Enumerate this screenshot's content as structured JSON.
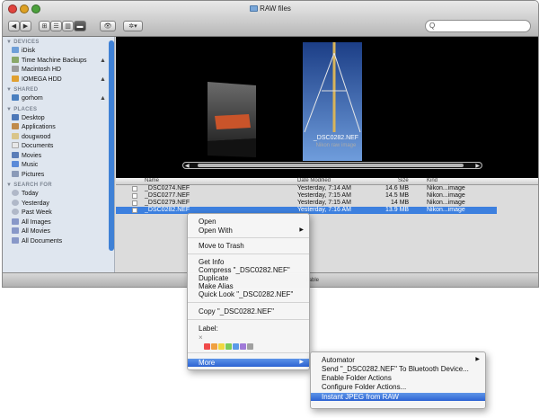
{
  "window": {
    "title": "RAW files"
  },
  "search": {
    "placeholder": "Q"
  },
  "sidebar": {
    "devices_header": "DEVICES",
    "devices": [
      {
        "label": "iDisk",
        "color": "#6f9fd8"
      },
      {
        "label": "Time Machine Backups",
        "color": "#8aa86a",
        "eject": "▲"
      },
      {
        "label": "Macintosh HD",
        "color": "#9c9c9c"
      },
      {
        "label": "IOMEGA HDD",
        "color": "#e0a030",
        "eject": "▲"
      }
    ],
    "shared_header": "SHARED",
    "shared": [
      {
        "label": "gorhom",
        "color": "#4a7fc0",
        "eject": "▲"
      }
    ],
    "places_header": "PLACES",
    "places": [
      {
        "label": "Desktop",
        "color": "#4d78b8"
      },
      {
        "label": "Applications",
        "color": "#c08a4a"
      },
      {
        "label": "dougwood",
        "color": "#d9c58a"
      },
      {
        "label": "Documents",
        "color": "#e8e8e8"
      },
      {
        "label": "Movies",
        "color": "#5a7db8"
      },
      {
        "label": "Music",
        "color": "#5a8ad8"
      },
      {
        "label": "Pictures",
        "color": "#8a9ab8"
      }
    ],
    "search_header": "SEARCH FOR",
    "searches": [
      {
        "label": "Today",
        "color": "#b0b8c8"
      },
      {
        "label": "Yesterday",
        "color": "#b0b8c8"
      },
      {
        "label": "Past Week",
        "color": "#b0b8c8"
      },
      {
        "label": "All Images",
        "color": "#8898c8"
      },
      {
        "label": "All Movies",
        "color": "#8898c8"
      },
      {
        "label": "All Documents",
        "color": "#8898c8"
      }
    ]
  },
  "coverflow": {
    "filename": "_DSC0282.NEF",
    "kind": "Nikon raw image"
  },
  "list": {
    "headers": {
      "name": "Name",
      "date": "Date Modified",
      "size": "Size",
      "kind": "Kind"
    },
    "rows": [
      {
        "name": "_DSC0274.NEF",
        "date": "Yesterday, 7:14 AM",
        "size": "14.6 MB",
        "kind": "Nikon...image"
      },
      {
        "name": "_DSC0277.NEF",
        "date": "Yesterday, 7:15 AM",
        "size": "14.5 MB",
        "kind": "Nikon...image"
      },
      {
        "name": "_DSC0279.NEF",
        "date": "Yesterday, 7:15 AM",
        "size": "14 MB",
        "kind": "Nikon...image"
      },
      {
        "name": "_DSC0282.NEF",
        "date": "Yesterday, 7:16 AM",
        "size": "13.9 MB",
        "kind": "Nikon...image"
      }
    ]
  },
  "statusbar": {
    "text": "ilable"
  },
  "context_menu": {
    "open": "Open",
    "open_with": "Open With",
    "move_to_trash": "Move to Trash",
    "get_info": "Get Info",
    "compress": "Compress \"_DSC0282.NEF\"",
    "duplicate": "Duplicate",
    "make_alias": "Make Alias",
    "quick_look": "Quick Look \"_DSC0282.NEF\"",
    "copy": "Copy \"_DSC0282.NEF\"",
    "label": "Label:",
    "label_none": "×",
    "label_colors": [
      "#f04a4a",
      "#f0a040",
      "#f0d840",
      "#7acb5a",
      "#5a9ae8",
      "#a07ad8",
      "#a0a0a0"
    ],
    "more": "More"
  },
  "submenu": {
    "automator": "Automator",
    "send_bluetooth": "Send \"_DSC0282.NEF\" To Bluetooth Device...",
    "enable_folder_actions": "Enable Folder Actions",
    "configure_folder_actions": "Configure Folder Actions...",
    "instant_jpeg": "Instant JPEG from RAW"
  },
  "colors": {
    "accent": "#3d80df",
    "highlight": "#2d63d2"
  }
}
